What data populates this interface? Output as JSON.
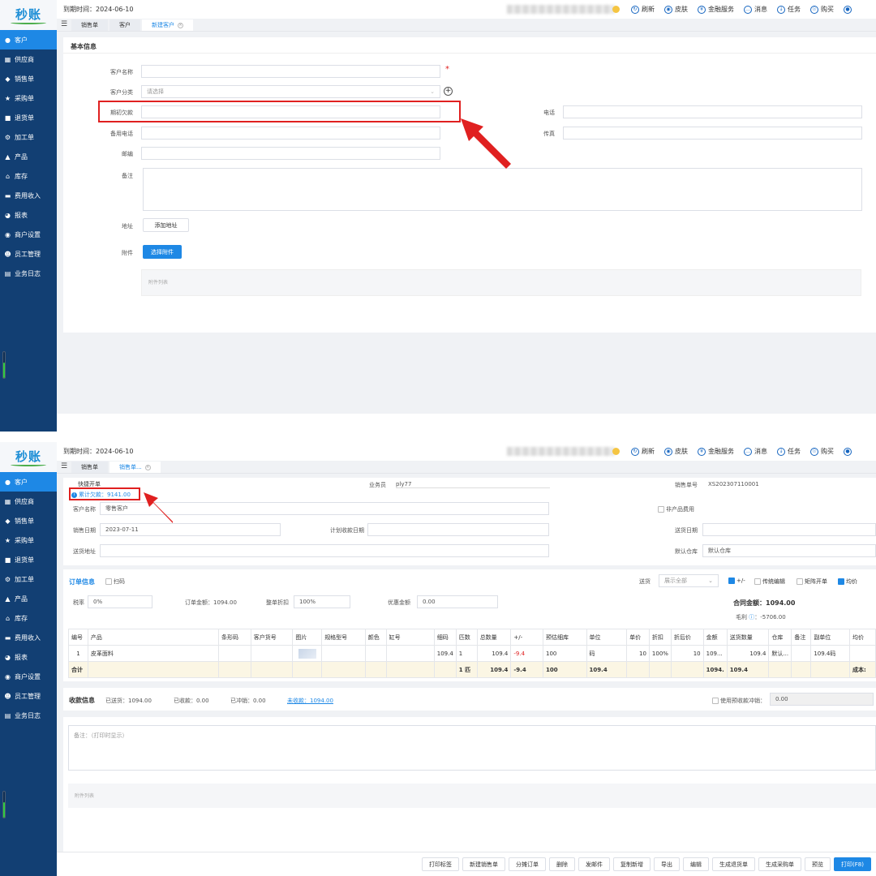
{
  "common": {
    "logo": "秒账",
    "expiry": "到期时间：2024-06-10",
    "toolbar": [
      "刷新",
      "皮肤",
      "金融服务",
      "消息",
      "任务",
      "购买"
    ],
    "nav": [
      "客户",
      "供应商",
      "销售单",
      "采购单",
      "退货单",
      "加工单",
      "产品",
      "库存",
      "费用收入",
      "报表",
      "商户设置",
      "员工管理",
      "业务日志"
    ],
    "nav_icons": [
      "users-icon",
      "supplier-icon",
      "sales-icon",
      "purchase-icon",
      "return-icon",
      "process-icon",
      "product-icon",
      "warehouse-icon",
      "expense-icon",
      "report-icon",
      "settings-icon",
      "staff-icon",
      "log-icon"
    ]
  },
  "shot1": {
    "tabs": [
      "销售单",
      "客户",
      "新建客户"
    ],
    "section_title": "基本信息",
    "fields": {
      "customer_name": "客户名称",
      "category": "客户分类",
      "category_placeholder": "请选择",
      "opening_debt": "期初欠款",
      "phone": "电话",
      "backup_phone": "备用电话",
      "fax": "传真",
      "zip": "邮编",
      "remark": "备注",
      "address": "地址",
      "add_address": "添加地址",
      "attachment": "附件",
      "choose_attachment": "选择附件",
      "attachment_list": "附件列表"
    },
    "required_mark": "*"
  },
  "shot2": {
    "tabs": [
      "销售单",
      "销售单..."
    ],
    "quick_order": "快捷开单",
    "cumulative_debt": "累计欠款：9141.00",
    "salesperson_label": "业务员",
    "salesperson": "ply77",
    "order_no_label": "销售单号",
    "order_no": "XS202307110001",
    "customer_label": "客户名称",
    "customer": "零售客户",
    "non_product_fee": "非产品费用",
    "sale_date_label": "销售日期",
    "sale_date": "2023-07-11",
    "plan_collect_label": "计划收款日期",
    "delivery_date_label": "送货日期",
    "delivery_addr_label": "送货地址",
    "default_wh_label": "默认仓库",
    "default_wh": "默认仓库",
    "order_info": "订单信息",
    "scan": "扫码",
    "send_label": "送货",
    "send_select": "展示全部",
    "opt_pm": "+/-",
    "opt_trad": "传统编辑",
    "opt_matrix": "矩阵开单",
    "opt_avg": "均价",
    "tax_label": "税率",
    "tax": "0%",
    "order_amt_label": "订单金额：1094.00",
    "discount_label": "整单折扣",
    "discount": "100%",
    "coupon_label": "优惠金额",
    "coupon": "0.00",
    "contract_amt": "合同金额：",
    "contract_val": "1094.00",
    "gross_profit": "毛利",
    "gross_val": "：-5706.00",
    "table_headers": [
      "编号",
      "产品",
      "条形码",
      "客户货号",
      "图片",
      "规格型号",
      "颜色",
      "缸号",
      "细码",
      "匹数",
      "总数量",
      "+/-",
      "预估细库",
      "单位",
      "单价",
      "折扣",
      "折后价",
      "金额",
      "送货数量",
      "仓库",
      "备注",
      "副单位",
      "均价"
    ],
    "row": [
      "1",
      "皮革面料",
      "",
      "",
      "",
      "",
      "",
      "",
      "109.4",
      "1",
      "109.4",
      "-9.4",
      "100",
      "码",
      "10",
      "100%",
      "10",
      "109...",
      "109.4",
      "默认...",
      "",
      "109.4码",
      ""
    ],
    "total": [
      "合计",
      "",
      "",
      "",
      "",
      "",
      "",
      "",
      "",
      "1 匹",
      "109.4",
      "-9.4",
      "100",
      "109.4",
      "",
      "",
      "",
      "1094.",
      "109.4",
      "",
      "",
      "",
      "成本:"
    ],
    "pay_info": "收款信息",
    "sent": "已送货：1094.00",
    "received": "已收款：0.00",
    "offset": "已冲销：0.00",
    "unreceived": "未收款：1094.00",
    "use_prepay": "使用预收款冲销：",
    "prepay_val": "0.00",
    "note_placeholder": "备注：（打印时显示）",
    "attach_list": "附件列表",
    "footer_buttons": [
      "打印标签",
      "新建销售单",
      "分摊订单",
      "删除",
      "发邮件",
      "复制新增",
      "导出",
      "编辑",
      "生成退货单",
      "生成采购单",
      "预览",
      "打印(F8)"
    ]
  }
}
